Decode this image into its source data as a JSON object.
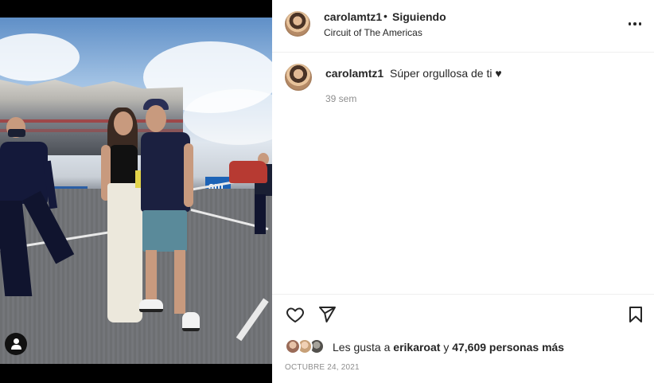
{
  "post": {
    "username": "carolamtz1",
    "separator": "•",
    "follow_status": "Siguiendo",
    "location": "Circuit of The Americas",
    "photo_banner_text": "am"
  },
  "caption": {
    "username": "carolamtz1",
    "text": "Súper orgullosa de ti ♥",
    "time_ago": "39 sem"
  },
  "engagement": {
    "likes_prefix": "Les gusta a",
    "liker_name": "erikaroat",
    "likes_connector": "y",
    "likes_count_text": "47,609 personas más",
    "date": "OCTUBRE 24, 2021"
  },
  "icons": {
    "more": "more-horizontal-icon",
    "like": "heart-icon",
    "share": "paper-plane-icon",
    "save": "bookmark-icon",
    "tag": "user-tag-icon"
  },
  "colors": {
    "text_primary": "#262626",
    "text_secondary": "#8e8e8e",
    "divider": "#efefef",
    "banner_blue": "#1d63b6"
  }
}
